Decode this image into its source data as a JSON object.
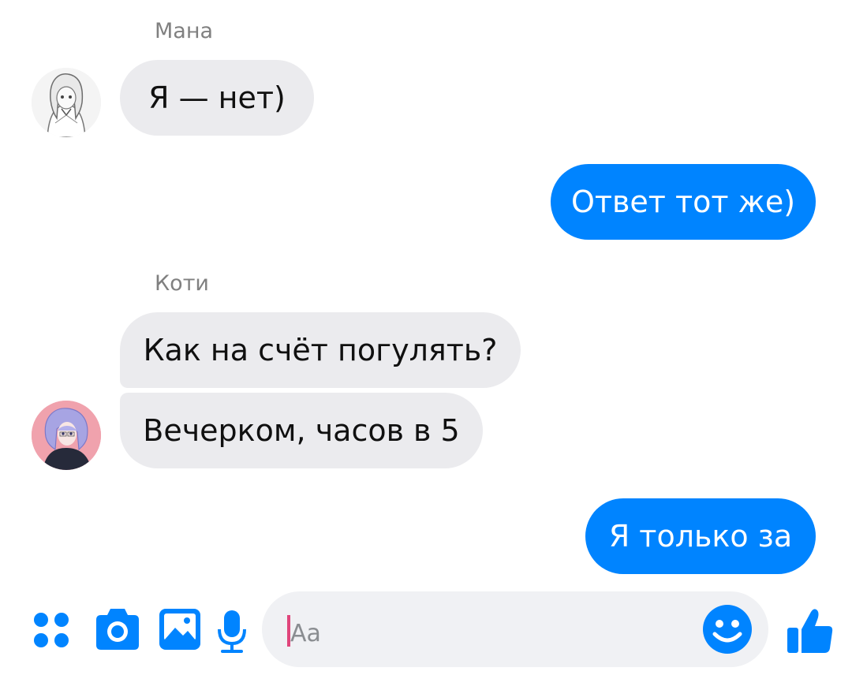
{
  "thread": {
    "messages": [
      {
        "sender": "Мана",
        "text": "Я — нет)"
      },
      {
        "sender": "me",
        "text": "Ответ тот же)"
      },
      {
        "sender": "Коти",
        "text": "Как на счёт погулять?"
      },
      {
        "sender": "Коти",
        "text": "Вечерком, часов в 5"
      },
      {
        "sender": "me",
        "text": "Я только за"
      }
    ]
  },
  "composer": {
    "placeholder": "Aa",
    "tools": [
      "apps-grid-icon",
      "camera-icon",
      "gallery-icon",
      "microphone-icon"
    ],
    "emoji_icon": "smiley-icon",
    "send_icon": "thumbs-up-icon"
  },
  "colors": {
    "accent": "#0084ff",
    "incoming_bubble": "#ebebee",
    "caret": "#e0457b"
  }
}
